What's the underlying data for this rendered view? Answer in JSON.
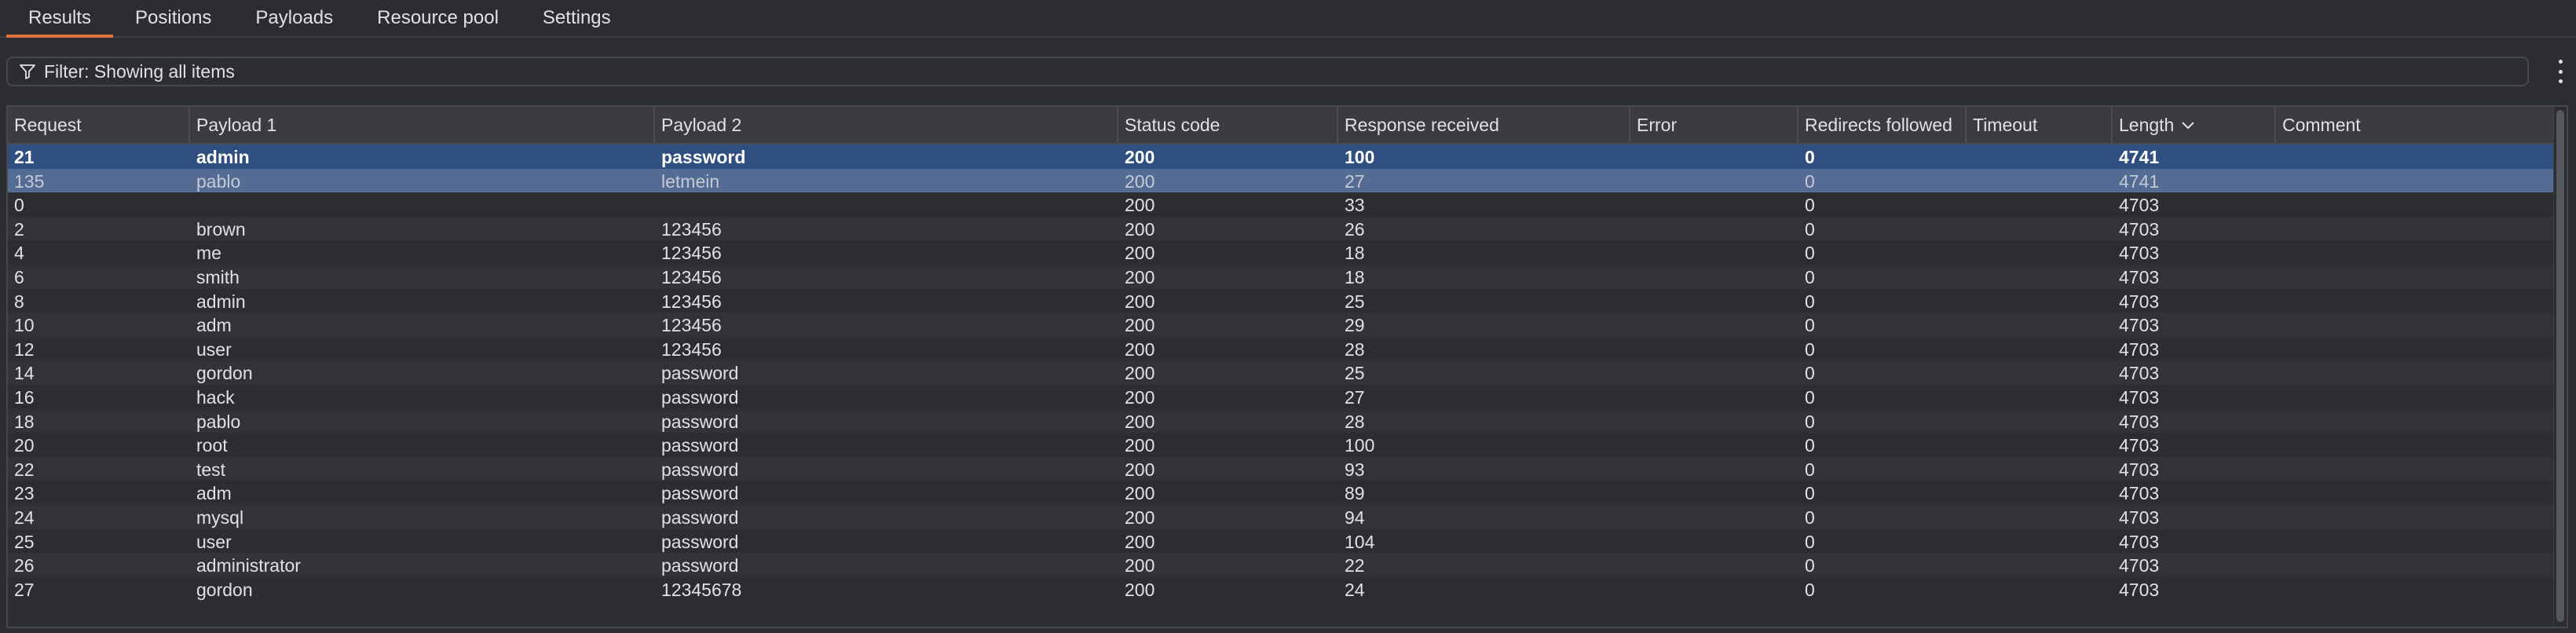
{
  "tabs": [
    {
      "label": "Results",
      "active": true
    },
    {
      "label": "Positions",
      "active": false
    },
    {
      "label": "Payloads",
      "active": false
    },
    {
      "label": "Resource pool",
      "active": false
    },
    {
      "label": "Settings",
      "active": false
    }
  ],
  "filter": {
    "text": "Filter: Showing all items",
    "icon": "filter-icon"
  },
  "menu_icon": "kebab-menu-icon",
  "table": {
    "columns": [
      "Request",
      "Payload 1",
      "Payload 2",
      "Status code",
      "Response received",
      "Error",
      "Redirects followed",
      "Timeout",
      "Length",
      "Comment"
    ],
    "sort_column": "Length",
    "sort_direction": "descending",
    "rows": [
      [
        "21",
        "admin",
        "password",
        "200",
        "100",
        "",
        "0",
        "",
        "4741",
        ""
      ],
      [
        "135",
        "pablo",
        "letmein",
        "200",
        "27",
        "",
        "0",
        "",
        "4741",
        ""
      ],
      [
        "0",
        "",
        "",
        "200",
        "33",
        "",
        "0",
        "",
        "4703",
        ""
      ],
      [
        "2",
        "brown",
        "123456",
        "200",
        "26",
        "",
        "0",
        "",
        "4703",
        ""
      ],
      [
        "4",
        "me",
        "123456",
        "200",
        "18",
        "",
        "0",
        "",
        "4703",
        ""
      ],
      [
        "6",
        "smith",
        "123456",
        "200",
        "18",
        "",
        "0",
        "",
        "4703",
        ""
      ],
      [
        "8",
        "admin",
        "123456",
        "200",
        "25",
        "",
        "0",
        "",
        "4703",
        ""
      ],
      [
        "10",
        "adm",
        "123456",
        "200",
        "29",
        "",
        "0",
        "",
        "4703",
        ""
      ],
      [
        "12",
        "user",
        "123456",
        "200",
        "28",
        "",
        "0",
        "",
        "4703",
        ""
      ],
      [
        "14",
        "gordon",
        "password",
        "200",
        "25",
        "",
        "0",
        "",
        "4703",
        ""
      ],
      [
        "16",
        "hack",
        "password",
        "200",
        "27",
        "",
        "0",
        "",
        "4703",
        ""
      ],
      [
        "18",
        "pablo",
        "password",
        "200",
        "28",
        "",
        "0",
        "",
        "4703",
        ""
      ],
      [
        "20",
        "root",
        "password",
        "200",
        "100",
        "",
        "0",
        "",
        "4703",
        ""
      ],
      [
        "22",
        "test",
        "password",
        "200",
        "93",
        "",
        "0",
        "",
        "4703",
        ""
      ],
      [
        "23",
        "adm",
        "password",
        "200",
        "89",
        "",
        "0",
        "",
        "4703",
        ""
      ],
      [
        "24",
        "mysql",
        "password",
        "200",
        "94",
        "",
        "0",
        "",
        "4703",
        ""
      ],
      [
        "25",
        "user",
        "password",
        "200",
        "104",
        "",
        "0",
        "",
        "4703",
        ""
      ],
      [
        "26",
        "administrator",
        "password",
        "200",
        "22",
        "",
        "0",
        "",
        "4703",
        ""
      ],
      [
        "27",
        "gordon",
        "12345678",
        "200",
        "24",
        "",
        "0",
        "",
        "4703",
        ""
      ]
    ],
    "selected_rows": [
      0,
      1
    ]
  },
  "colors": {
    "accent": "#e0733a",
    "selected_row": "#2e4f7f",
    "selected_row_secondary": "#546b93",
    "background": "#2b2d30"
  }
}
